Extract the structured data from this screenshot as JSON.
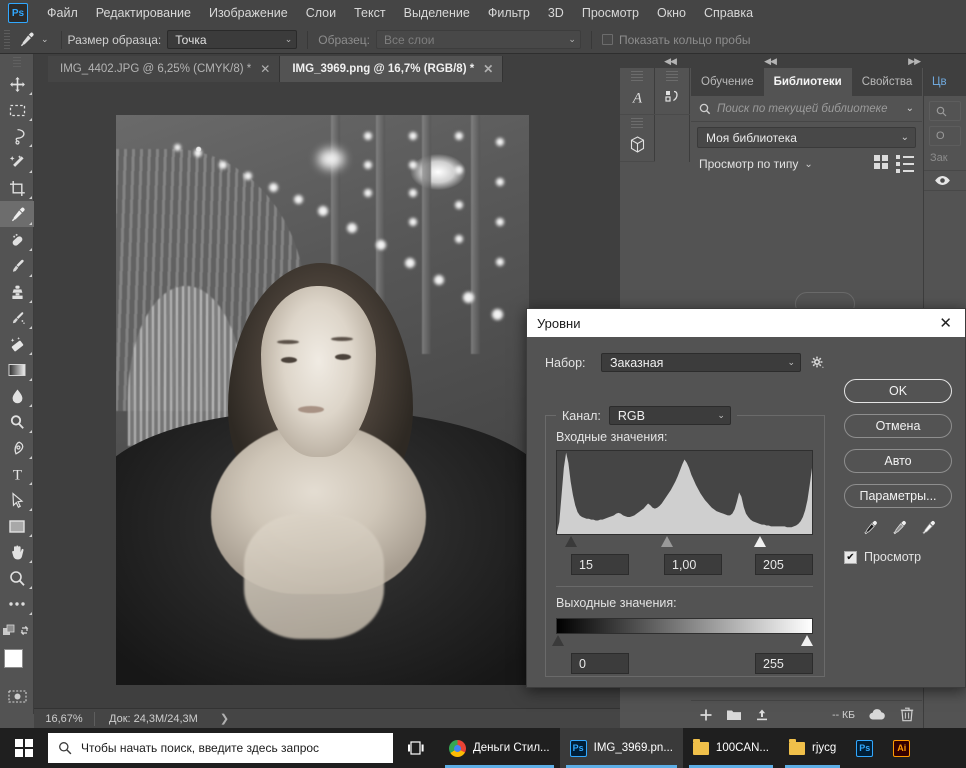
{
  "app": {
    "logo": "Ps"
  },
  "menubar": {
    "items": [
      "Файл",
      "Редактирование",
      "Изображение",
      "Слои",
      "Текст",
      "Выделение",
      "Фильтр",
      "3D",
      "Просмотр",
      "Окно",
      "Справка"
    ]
  },
  "options_bar": {
    "tool_icon": "eyedropper-icon",
    "sample_size_label": "Размер образца:",
    "sample_size_value": "Точка",
    "sample_label": "Образец:",
    "sample_value": "Все слои",
    "show_ring_label": "Показать кольцо пробы",
    "show_ring_checked": false
  },
  "toolbar": {
    "tools": [
      {
        "name": "move-tool",
        "icon": "move-icon"
      },
      {
        "name": "marquee-tool",
        "icon": "rectangular-marquee-icon"
      },
      {
        "name": "lasso-tool",
        "icon": "lasso-icon"
      },
      {
        "name": "magic-wand-tool",
        "icon": "magic-wand-icon"
      },
      {
        "name": "crop-tool",
        "icon": "crop-icon"
      },
      {
        "name": "eyedropper-tool",
        "icon": "eyedropper-icon",
        "active": true
      },
      {
        "name": "healing-brush-tool",
        "icon": "healing-brush-icon"
      },
      {
        "name": "brush-tool",
        "icon": "brush-icon"
      },
      {
        "name": "clone-stamp-tool",
        "icon": "clone-stamp-icon"
      },
      {
        "name": "history-brush-tool",
        "icon": "history-brush-icon"
      },
      {
        "name": "eraser-tool",
        "icon": "eraser-icon"
      },
      {
        "name": "gradient-tool",
        "icon": "gradient-icon"
      },
      {
        "name": "blur-tool",
        "icon": "waterdrop-icon"
      },
      {
        "name": "dodge-tool",
        "icon": "dodge-icon"
      },
      {
        "name": "pen-tool",
        "icon": "pen-icon"
      },
      {
        "name": "type-tool",
        "icon": "type-T-icon"
      },
      {
        "name": "path-selection-tool",
        "icon": "arrow-pointer-icon"
      },
      {
        "name": "shape-tool",
        "icon": "rectangle-shape-icon"
      },
      {
        "name": "hand-tool",
        "icon": "hand-icon"
      },
      {
        "name": "zoom-tool",
        "icon": "magnifier-icon"
      },
      {
        "name": "edit-toolbar",
        "icon": "ellipsis-icon"
      }
    ],
    "foreground_color": "#ffffff",
    "background_color": "#000000"
  },
  "document_tabs": [
    {
      "label": "IMG_4402.JPG @ 6,25% (CMYK/8) *",
      "active": false
    },
    {
      "label": "IMG_3969.png @ 16,7% (RGB/8) *",
      "active": true
    }
  ],
  "status_bar": {
    "zoom": "16,67%",
    "doc_info": "Док: 24,3M/24,3M"
  },
  "right_dock": {
    "rail_icons": [
      "character-panel-icon",
      "paragraph-panel-icon",
      "3d-panel-icon"
    ],
    "tabs": [
      {
        "label": "Обучение",
        "active": false
      },
      {
        "label": "Библиотеки",
        "active": true
      },
      {
        "label": "Свойства",
        "active": false
      }
    ],
    "menu_icon": "hamburger-menu-icon",
    "search_placeholder": "Поиск по текущей библиотеке",
    "library_selected": "Моя библиотека",
    "view_by_label": "Просмотр по типу",
    "footer": {
      "size": "-- КБ"
    },
    "edge_panel": {
      "tab": "Цв",
      "chip_text": "Зак"
    }
  },
  "dialog": {
    "title": "Уровни",
    "close_icon": "close-icon",
    "preset_label": "Набор:",
    "preset_value": "Заказная",
    "gear_icon": "gear-icon",
    "channel_label": "Канал:",
    "channel_value": "RGB",
    "input_levels_label": "Входные значения:",
    "input_black": "15",
    "input_gamma": "1,00",
    "input_white": "205",
    "output_levels_label": "Выходные значения:",
    "output_black": "0",
    "output_white": "255",
    "buttons": {
      "ok": "OK",
      "cancel": "Отмена",
      "auto": "Авто",
      "options": "Параметры..."
    },
    "eyedroppers": [
      "set-black-point-icon",
      "set-gray-point-icon",
      "set-white-point-icon"
    ],
    "preview_label": "Просмотр",
    "preview_checked": true,
    "histogram": {
      "values": [
        2,
        14,
        46,
        78,
        96,
        84,
        62,
        46,
        34,
        26,
        22,
        20,
        19,
        18,
        18,
        17,
        17,
        16,
        16,
        17,
        17,
        18,
        19,
        20,
        21,
        22,
        24,
        25,
        24,
        22,
        21,
        20,
        20,
        21,
        22,
        24,
        26,
        28,
        30,
        33,
        36,
        34,
        31,
        30,
        31,
        33,
        36,
        40,
        44,
        48,
        52,
        57,
        62,
        68,
        75,
        82,
        88,
        84,
        78,
        70,
        64,
        58,
        53,
        48,
        44,
        40,
        37,
        34,
        31,
        29,
        27,
        26,
        25,
        24,
        23,
        22,
        22,
        24,
        29,
        38,
        49,
        44,
        32,
        24,
        20,
        17,
        15,
        14,
        13,
        12,
        11,
        11,
        10,
        10,
        9,
        9,
        9,
        9,
        9,
        9,
        9,
        8,
        8,
        8,
        9,
        10,
        12,
        15,
        20,
        28,
        40,
        58,
        78
      ]
    }
  },
  "taskbar": {
    "search_placeholder": "Чтобы начать поиск, введите здесь запрос",
    "search_icon": "search-icon",
    "task_view_icon": "task-view-icon",
    "apps": [
      {
        "label": "Деньги Стил...",
        "icon": "chrome-icon",
        "active": false,
        "running": true
      },
      {
        "label": "IMG_3969.pn...",
        "icon": "photoshop-icon",
        "active": true,
        "running": true
      },
      {
        "label": "100CAN...",
        "icon": "folder-icon",
        "active": false,
        "running": true
      },
      {
        "label": "rjycg",
        "icon": "folder-icon",
        "active": false,
        "running": true
      },
      {
        "label": "",
        "icon": "photoshop-icon",
        "active": false,
        "running": false
      },
      {
        "label": "",
        "icon": "illustrator-icon",
        "active": false,
        "running": false
      }
    ]
  }
}
